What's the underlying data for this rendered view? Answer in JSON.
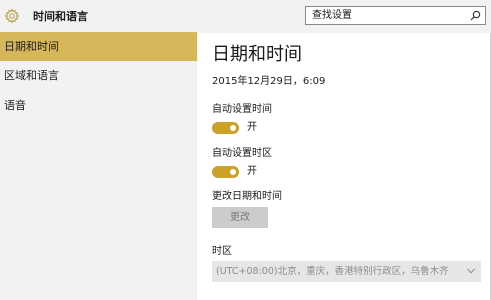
{
  "app": {
    "title": "时间和语言"
  },
  "search": {
    "placeholder": "查找设置"
  },
  "sidebar": {
    "items": [
      {
        "label": "日期和时间",
        "active": true
      },
      {
        "label": "区域和语言",
        "active": false
      },
      {
        "label": "语音",
        "active": false
      }
    ]
  },
  "main": {
    "title": "日期和时间",
    "current_datetime": "2015年12月29日，6:09",
    "auto_time": {
      "label": "自动设置时间",
      "state": "开",
      "on": true
    },
    "auto_timezone": {
      "label": "自动设置时区",
      "state": "开",
      "on": true
    },
    "change_datetime": {
      "label": "更改日期和时间",
      "button_label": "更改",
      "enabled": false
    },
    "timezone": {
      "label": "时区",
      "value": "(UTC+08:00)北京，重庆，香港特别行政区，乌鲁木齐",
      "enabled": false
    }
  },
  "colors": {
    "accent": "#d7b75b",
    "toggle_on": "#c9a227",
    "sidebar_bg": "#f2f2f2",
    "disabled_bg": "#cccccc"
  },
  "icons": {
    "app": "gear-icon",
    "search": "search-icon",
    "dropdown": "chevron-down-icon"
  }
}
